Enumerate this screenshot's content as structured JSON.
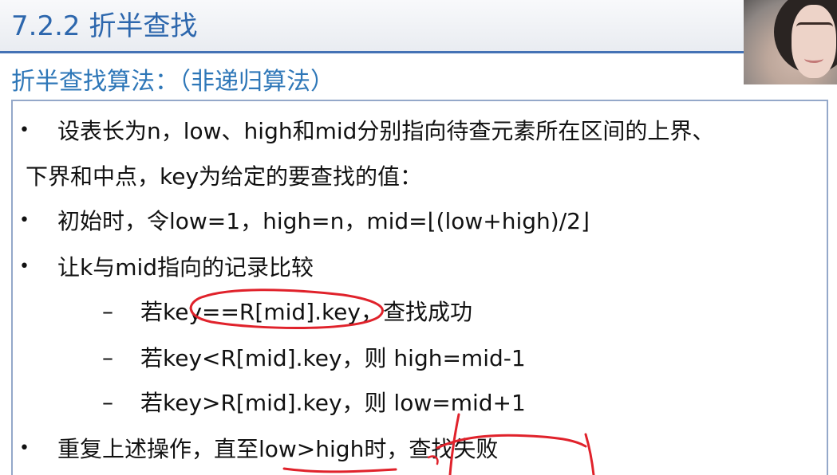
{
  "slide": {
    "title": "7.2.2 折半查找",
    "subtitle": "折半查找算法：（非递归算法）"
  },
  "content": {
    "bullet_char": "•",
    "dash_char": "–",
    "line1": "设表长为n，low、high和mid分别指向待查元素所在区间的上界、",
    "line2": "下界和中点，key为给定的要查找的值：",
    "line3": "初始时，令low=1，high=n，mid=⌊(low+high)/2⌋",
    "line4": "让k与mid指向的记录比较",
    "sub1": "若key==R[mid].key，查找成功",
    "sub2": "若key<R[mid].key，则 high=mid-1",
    "sub3": "若key>R[mid].key，则 low=mid+1",
    "line5": "重复上述操作，直至low>high时，查找失败"
  },
  "colors": {
    "title": "#2d67ad",
    "subtitle": "#2e77b8",
    "rule": "#4472b5",
    "box_border": "#94a8c9",
    "annotation": "#e0222b"
  },
  "annotations": {
    "type": "red-pen-marks"
  }
}
